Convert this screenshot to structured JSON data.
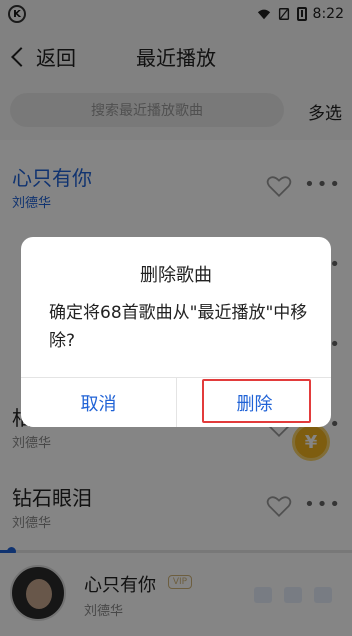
{
  "status": {
    "time": "8:22",
    "app_badge": "K"
  },
  "header": {
    "back_label": "返回",
    "title": "最近播放"
  },
  "search": {
    "placeholder": "搜索最近播放歌曲",
    "multi_select_label": "多选"
  },
  "songs": [
    {
      "title": "心只有你",
      "artist": "刘德华",
      "playing": true
    },
    {
      "title": "",
      "artist": "",
      "playing": false
    },
    {
      "title": "",
      "artist": "",
      "playing": false
    },
    {
      "title": "相思成灾",
      "artist": "刘德华",
      "playing": false
    },
    {
      "title": "钻石眼泪",
      "artist": "刘德华",
      "playing": false
    }
  ],
  "coin_symbol": "¥",
  "playback_progress": 0.03,
  "player": {
    "title": "心只有你",
    "vip_badge": "VIP",
    "artist": "刘德华"
  },
  "dialog": {
    "title": "删除歌曲",
    "message": "确定将68首歌曲从\"最近播放\"中移除?",
    "cancel_label": "取消",
    "delete_label": "删除"
  },
  "colors": {
    "accent": "#1f62d6",
    "highlight_box": "#e23b3b",
    "coin": "#f2b21d"
  }
}
